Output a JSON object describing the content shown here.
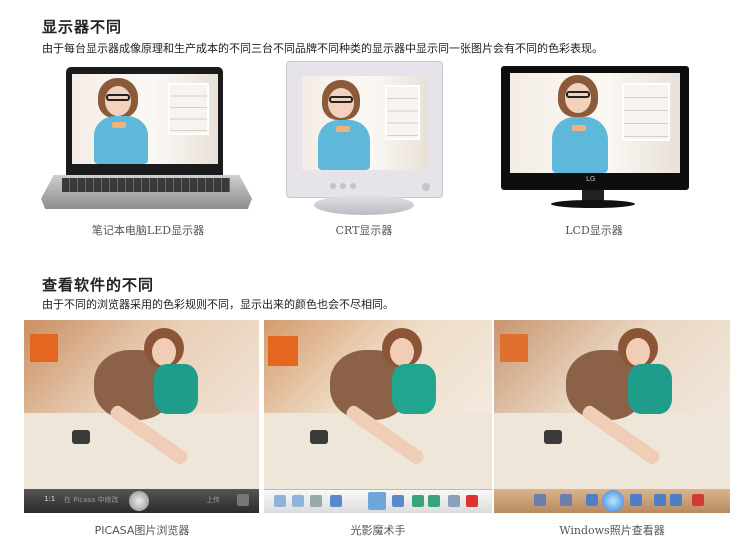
{
  "section1": {
    "title": "显示器不同",
    "description": "由于每台显示器成像原理和生产成本的不同三台不同品牌不同种类的显示器中显示同一张图片会有不同的色彩表现。",
    "monitors": [
      {
        "caption": "笔记本电脑LED显示器"
      },
      {
        "caption": "CRT显示器"
      },
      {
        "caption": "LCD显示器",
        "logo": "LG"
      }
    ]
  },
  "section2": {
    "title": "查看软件的不同",
    "description": "由于不同的浏览器采用的色彩规则不同，显示出来的颜色也会不尽相同。",
    "viewers": [
      {
        "caption": "PICASA图片浏览器",
        "toolbar_text": "1:1",
        "toolbar_label": "在 Picasa 中修改",
        "toolbar_upload": "上传"
      },
      {
        "caption": "光影魔术手"
      },
      {
        "caption": "Windows照片查看器"
      }
    ]
  },
  "colors": {
    "accent_orange": "#e4661f",
    "teal_top": "#1f9c8a",
    "blue_top": "#5db8d9"
  }
}
